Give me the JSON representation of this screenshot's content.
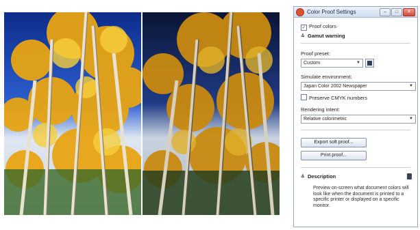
{
  "window": {
    "title": "Color Proof Settings",
    "minimize": "–",
    "maximize": "□",
    "close": "✕"
  },
  "proof_colors": {
    "label": "Proof colors",
    "checked": true
  },
  "gamut_warning": {
    "label": "Gamut warning"
  },
  "proof_preset": {
    "label": "Proof preset:",
    "value": "Custom"
  },
  "simulate_environment": {
    "label": "Simulate environment:",
    "value": "Japan Color 2002 Newspaper"
  },
  "preserve_cmyk": {
    "label": "Preserve CMYK numbers",
    "checked": false
  },
  "rendering_intent": {
    "label": "Rendering intent:",
    "value": "Relative colorimetric"
  },
  "buttons": {
    "export_soft_proof": "Export soft proof...",
    "print_proof": "Print proof..."
  },
  "description": {
    "title": "Description",
    "text": "Preview on-screen what document colors will look like when the document is printed to a specific printer or displayed on a specific monitor."
  },
  "icons": {
    "app": "color-proof-app-icon",
    "save": "save-icon",
    "info": "info-icon",
    "collapse": "chevron-icon",
    "dropdown": "dropdown-arrow-icon"
  }
}
